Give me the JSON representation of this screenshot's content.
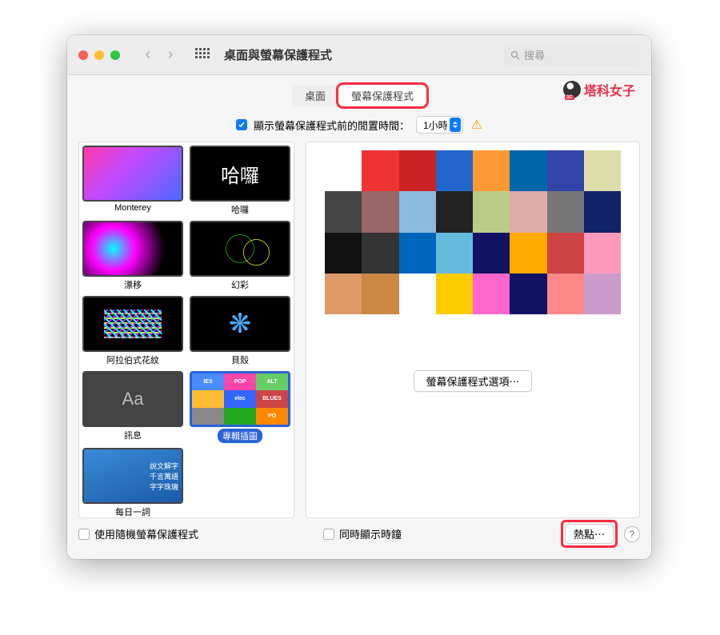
{
  "window": {
    "title": "桌面與螢幕保護程式"
  },
  "search": {
    "placeholder": "搜尋"
  },
  "watermark": {
    "text": "塔科女子"
  },
  "tabs": {
    "desktop": "桌面",
    "screensaver": "螢幕保護程式"
  },
  "idle": {
    "label": "顯示螢幕保護程式前的閒置時間：",
    "value": "1小時",
    "checked": true
  },
  "savers": [
    {
      "label": "Monterey",
      "kind": "monterey"
    },
    {
      "label": "哈囉",
      "kind": "hello",
      "text": "哈囉"
    },
    {
      "label": "漂移",
      "kind": "drift"
    },
    {
      "label": "幻彩",
      "kind": "fantasy"
    },
    {
      "label": "阿拉伯式花紋",
      "kind": "arabesque"
    },
    {
      "label": "貝殼",
      "kind": "shell"
    },
    {
      "label": "訊息",
      "kind": "message",
      "text": "Aa"
    },
    {
      "label": "專輯插圖",
      "kind": "album",
      "selected": true
    },
    {
      "label": "每日一詞",
      "kind": "word"
    }
  ],
  "word_lines": [
    "說文解字",
    "千言萬語",
    "字字珠璣"
  ],
  "album_tiles": [
    {
      "bg": "#4a8cff",
      "t": "IES"
    },
    {
      "bg": "#f4a",
      "t": "POP"
    },
    {
      "bg": "#6c6",
      "t": "ALT"
    },
    {
      "bg": "#fb3",
      "t": ""
    },
    {
      "bg": "#36f",
      "t": "elec"
    },
    {
      "bg": "#c44",
      "t": "BLUES"
    },
    {
      "bg": "#888",
      "t": ""
    },
    {
      "bg": "#2a2",
      "t": ""
    },
    {
      "bg": "#f80",
      "t": "PO"
    }
  ],
  "preview_tiles": [
    "#fff",
    "#e33",
    "#c22",
    "#26c",
    "#f93",
    "#06a",
    "#34a",
    "#dda",
    "#444",
    "#966",
    "#8bd",
    "#222",
    "#bc8",
    "#daa",
    "#777",
    "#126",
    "#111",
    "#333",
    "#06b",
    "#6bd",
    "#116",
    "#fa0",
    "#c44",
    "#f9b",
    "#d96",
    "#c84",
    "#fff",
    "#fc0",
    "#f6c",
    "#116",
    "#f88",
    "#c9c"
  ],
  "options_btn": "螢幕保護程式選項⋯",
  "footer": {
    "random": "使用隨機螢幕保護程式",
    "clock": "同時顯示時鐘",
    "hotcorners": "熱點⋯",
    "help": "?"
  }
}
